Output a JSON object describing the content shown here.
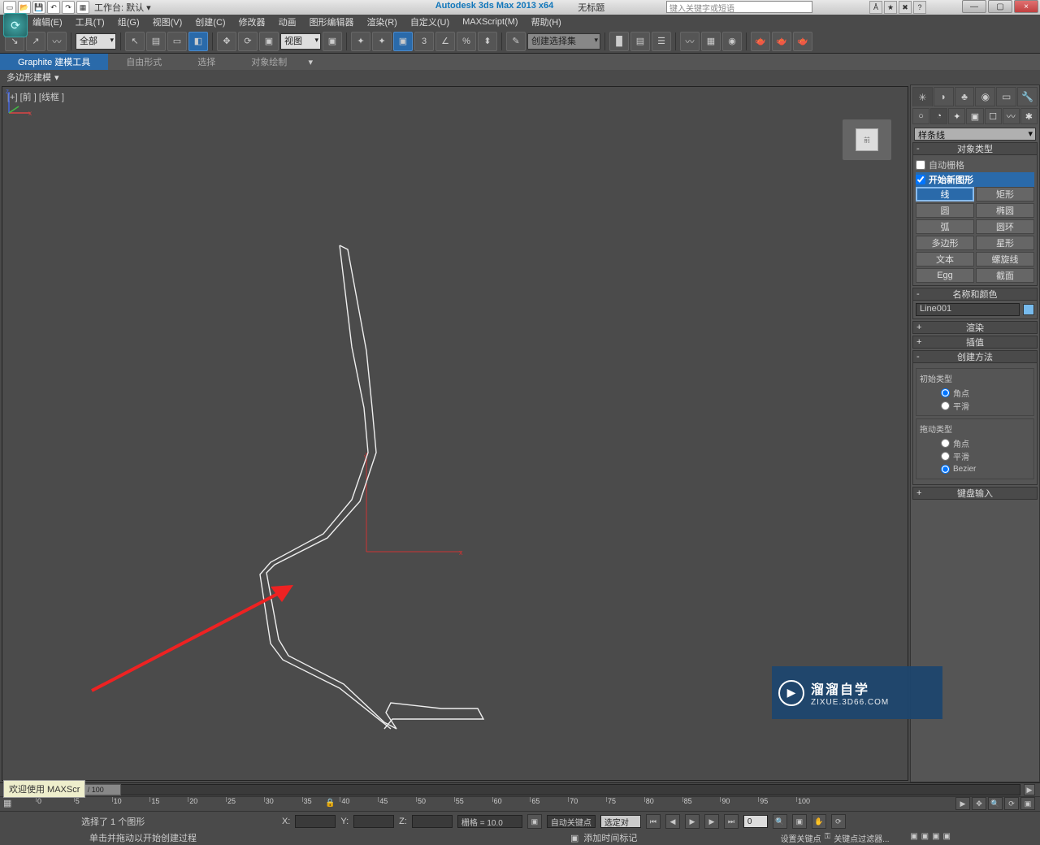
{
  "title": {
    "app": "Autodesk 3ds Max  2013 x64",
    "doc": "无标题",
    "workspace_label": "工作台: 默认  ▾"
  },
  "search_placeholder": "键入关键字或短语",
  "win": {
    "min": "—",
    "max": "▢",
    "close": "×"
  },
  "menubar": [
    "编辑(E)",
    "工具(T)",
    "组(G)",
    "视图(V)",
    "创建(C)",
    "修改器",
    "动画",
    "图形编辑器",
    "渲染(R)",
    "自定义(U)",
    "MAXScript(M)",
    "帮助(H)"
  ],
  "toolbar": {
    "filter": "全部",
    "viewmode": "视图",
    "create_set": "创建选择集"
  },
  "ribbon": {
    "tabs": [
      "Graphite 建模工具",
      "自由形式",
      "选择",
      "对象绘制"
    ],
    "sub": "多边形建模"
  },
  "viewport": {
    "label": "[+] [前 ] [线框 ]"
  },
  "time": {
    "slider": "0 / 100",
    "ticks": [
      "0",
      "5",
      "10",
      "15",
      "20",
      "25",
      "30",
      "35",
      "40",
      "45",
      "50",
      "55",
      "60",
      "65",
      "70",
      "75",
      "80",
      "85",
      "90",
      "95",
      "100"
    ]
  },
  "status": {
    "sel": "选择了 1 个图形",
    "x": "X:",
    "y": "Y:",
    "z": "Z:",
    "grid": "栅格 = 10.0",
    "autokey": "自动关键点",
    "select": "选定对",
    "setkey": "设置关键点",
    "keyfilter": "关键点过滤器...",
    "add_time": "添加时间标记",
    "prompt": "单击并拖动以开始创建过程",
    "welcome": "欢迎使用  MAXScr"
  },
  "cmd": {
    "combo": "样条线",
    "obj_type": "对象类型",
    "autogrid": "自动栅格",
    "start_new": "开始新图形",
    "shapes": [
      "线",
      "矩形",
      "圆",
      "椭圆",
      "弧",
      "圆环",
      "多边形",
      "星形",
      "文本",
      "螺旋线",
      "Egg",
      "截面"
    ],
    "name_color": "名称和颜色",
    "name": "Line001",
    "render": "渲染",
    "interp": "插值",
    "creation": "创建方法",
    "init_type": "初始类型",
    "drag_type": "拖动类型",
    "corner": "角点",
    "smooth": "平滑",
    "bezier": "Bezier",
    "keyboard": "键盘输入"
  },
  "watermark": {
    "t1": "溜溜自学",
    "t2": "ZIXUE.3D66.COM"
  }
}
